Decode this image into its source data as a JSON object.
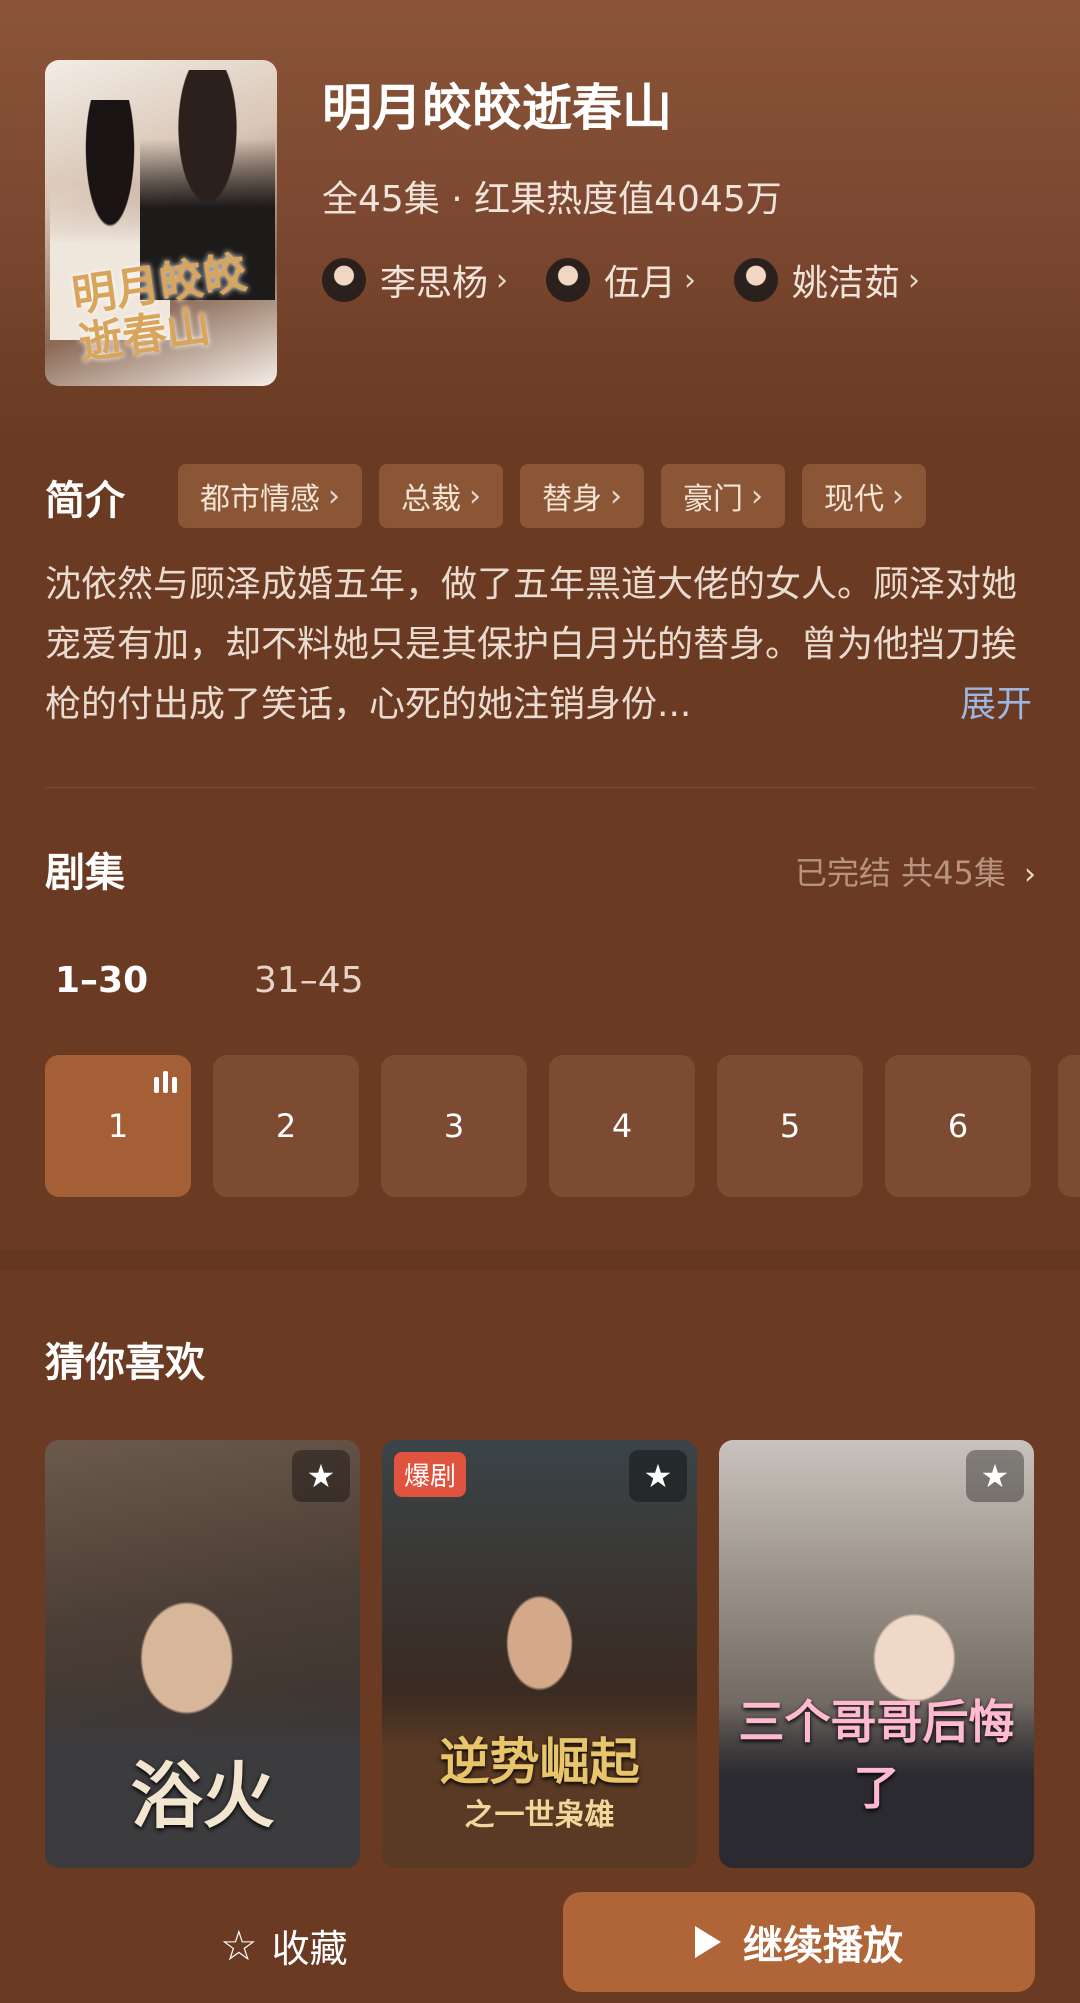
{
  "show": {
    "title": "明月皎皎逝春山",
    "meta": "全45集 · 红果热度值4045万",
    "poster_text": "明月皎皎逝春山",
    "actors": [
      {
        "name": "李思杨"
      },
      {
        "name": "伍月"
      },
      {
        "name": "姚洁茹"
      }
    ]
  },
  "intro": {
    "label": "简介",
    "tags": [
      "都市情感",
      "总裁",
      "替身",
      "豪门",
      "现代"
    ],
    "synopsis": "沈依然与顾泽成婚五年，做了五年黑道大佬的女人。顾泽对她宠爱有加，却不料她只是其保护白月光的替身。曾为他挡刀挨枪的付出成了笑话，心死的她注销身份...",
    "expand": "展开"
  },
  "episodes": {
    "label": "剧集",
    "status": "已完结 共45集",
    "ranges": [
      "1–30",
      "31–45"
    ],
    "items": [
      "1",
      "2",
      "3",
      "4",
      "5",
      "6"
    ]
  },
  "recommend": {
    "label": "猜你喜欢",
    "items": [
      {
        "title": "浴火",
        "badge": ""
      },
      {
        "title": "逆势崛起",
        "subtitle": "之一世枭雄",
        "badge": "爆剧"
      },
      {
        "title": "三个哥哥后悔了",
        "badge": ""
      }
    ]
  },
  "bottom": {
    "favorite": "收藏",
    "continue": "继续播放"
  },
  "colors": {
    "background": "#6a3a22",
    "accent": "#b06538",
    "tag_bg": "#8a5636",
    "expand_link": "#9db6e0"
  }
}
